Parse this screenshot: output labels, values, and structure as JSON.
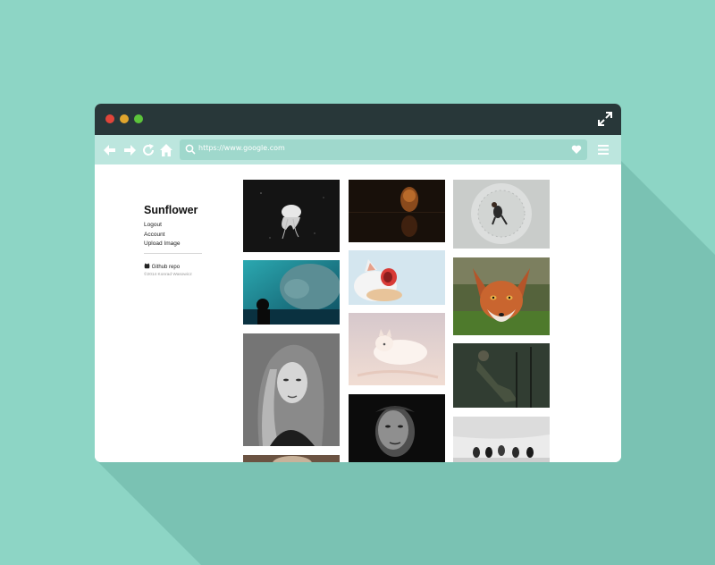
{
  "browser": {
    "url": "https://www.google.com",
    "controls": {
      "back_icon": "arrow-left-icon",
      "forward_icon": "arrow-right-icon",
      "reload_icon": "reload-icon",
      "home_icon": "home-icon",
      "search_icon": "search-icon",
      "bookmark_icon": "heart-icon",
      "menu_icon": "hamburger-menu-icon",
      "fullscreen_icon": "expand-icon"
    }
  },
  "sidebar": {
    "brand": "Sunflower",
    "links": [
      "Logout",
      "Account",
      "Upload Image"
    ],
    "repo_label": "Github repo",
    "copyright": "©2014 Konrad Wasowicz"
  },
  "gallery": {
    "photos": [
      "jellyfish",
      "manatee-aquarium",
      "woman-portrait",
      "partial-photo",
      "cat-reflection",
      "yawning-cat",
      "white-fox-snow",
      "man-portrait",
      "fisheye-person",
      "red-fox",
      "soldier-dark",
      "dogs-snow"
    ]
  },
  "colors": {
    "background": "#8dd5c5",
    "titlebar": "#283739",
    "toolbar": "#bce6de"
  }
}
